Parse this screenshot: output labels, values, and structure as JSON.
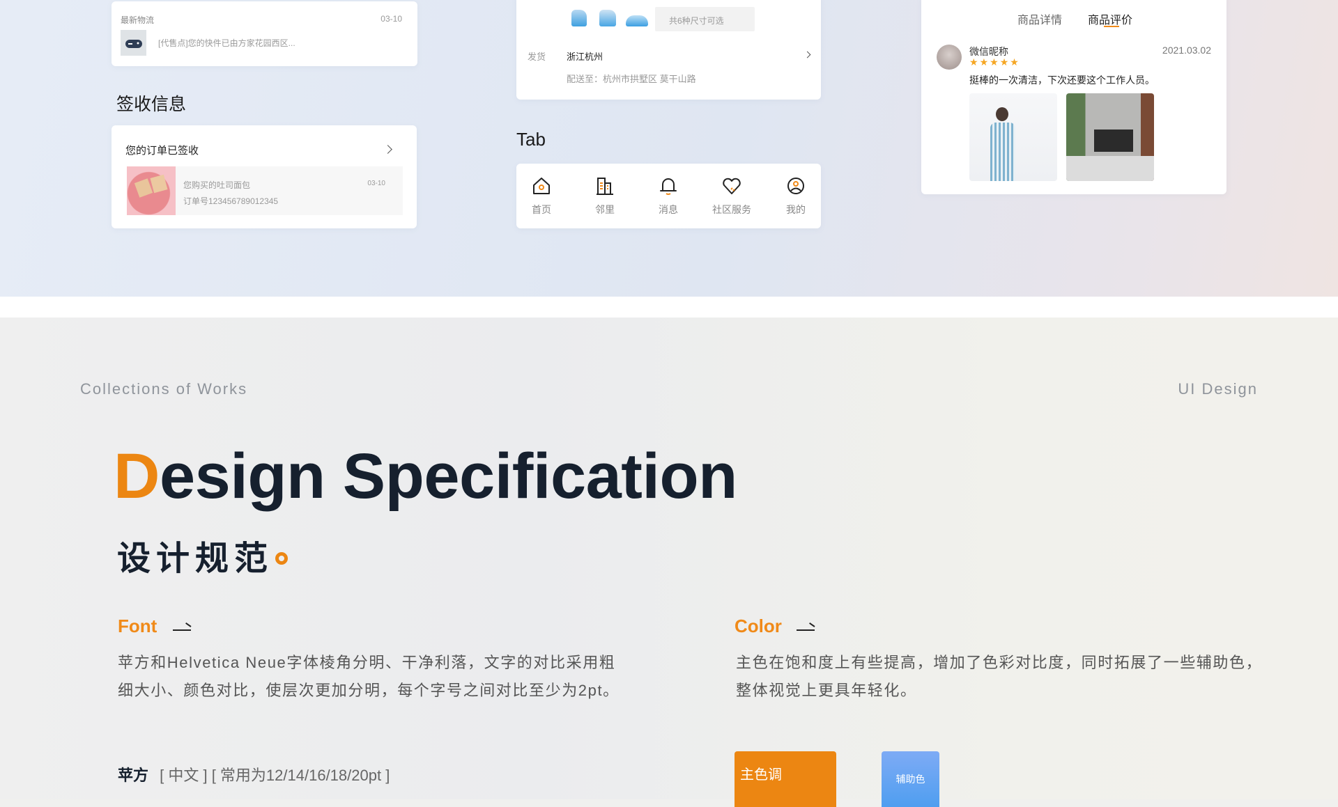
{
  "logistics_card": {
    "title": "最新物流",
    "date": "03-10",
    "message": "[代售点]您的快件已由方家花园西区..."
  },
  "receipt": {
    "section_title": "签收信息",
    "status": "您的订单已签收",
    "product": "您购买的吐司面包",
    "order_no": "订单号123456789012345",
    "date": "03-10"
  },
  "shipping": {
    "size_chip": "共6种尺寸可选",
    "ship_label": "发货",
    "ship_from": "浙江杭州",
    "deliver_to": "配送至：杭州市拱墅区 莫干山路"
  },
  "tabbar": {
    "section_title": "Tab",
    "items": [
      {
        "label": "首页",
        "icon": "home-icon"
      },
      {
        "label": "邻里",
        "icon": "building-icon"
      },
      {
        "label": "消息",
        "icon": "bell-icon"
      },
      {
        "label": "社区服务",
        "icon": "heart-hand-icon"
      },
      {
        "label": "我的",
        "icon": "user-icon"
      }
    ]
  },
  "review": {
    "tabs": [
      "商品详情",
      "商品评价"
    ],
    "active_tab": 1,
    "user": "微信昵称",
    "date": "2021.03.02",
    "rating": 5,
    "comment": "挺棒的一次清洁，下次还要这个工作人员。"
  },
  "spec": {
    "left_caption": "Collections of Works",
    "right_caption": "UI Design",
    "title_initial": "D",
    "title_rest": "esign Specification",
    "subtitle": "设计规范",
    "font": {
      "heading": "Font",
      "lines": [
        "苹方和Helvetica Neue字体棱角分明、干净利落，文字的对比采用粗",
        "细大小、颜色对比，使层次更加分明，每个字号之间对比至少为2pt。"
      ],
      "family": "苹方",
      "detail": "[ 中文 ] [ 常用为12/14/16/18/20pt ]"
    },
    "color": {
      "heading": "Color",
      "lines": [
        "主色在饱和度上有些提高，增加了色彩对比度，同时拓展了一些辅助色，",
        "整体视觉上更具年轻化。"
      ],
      "primary_label": "主色调",
      "secondary_label": "辅助色"
    }
  },
  "colors": {
    "accent": "#ec8612",
    "secondary": "#5b9ff2",
    "dark": "#16202e"
  }
}
